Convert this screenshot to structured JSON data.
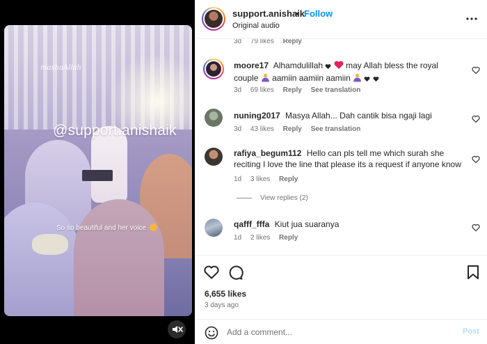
{
  "post": {
    "username": "support.anishaik",
    "separator": "•",
    "follow_label": "Follow",
    "audio": "Original audio",
    "more_icon": "more-horizontal-icon",
    "likes": "6,655 likes",
    "time_ago": "3 days ago"
  },
  "media": {
    "watermark_small": "mashaAllah",
    "overlay_handle": "@support.anishaik",
    "overlay_caption": "So so beautiful and her voice",
    "caption_emoji": "smiling-face-emoji",
    "mute_icon": "speaker-muted-icon"
  },
  "partial_comment": {
    "time": "3d",
    "likes": "79 likes",
    "reply": "Reply"
  },
  "comments": [
    {
      "user": "moore17",
      "text_a": "Alhamdulillah",
      "text_b": "may Allah bless the royal couple",
      "text_c": "aamiin aamiin aamiin",
      "time": "3d",
      "likes": "69 likes",
      "reply": "Reply",
      "translate": "See translation"
    },
    {
      "user": "nuning2017",
      "text": "Masya Allah... Dah cantik bisa ngaji lagi",
      "time": "3d",
      "likes": "43 likes",
      "reply": "Reply",
      "translate": "See translation"
    },
    {
      "user": "rafiya_begum112",
      "text": "Hello can pls tell me which surah she reciting I love the line that please its a request if anyone know",
      "time": "1d",
      "likes": "3 likes",
      "reply": "Reply",
      "view_replies": "View replies (2)"
    },
    {
      "user": "qafff_fffa",
      "text": "Kiut jua suaranya",
      "time": "1d",
      "likes": "2 likes",
      "reply": "Reply"
    }
  ],
  "add_comment": {
    "placeholder": "Add a comment...",
    "post_label": "Post"
  },
  "colors": {
    "accent": "#0095f6",
    "post_disabled": "#b2dffc",
    "heart": "#ed4956",
    "muted_text": "#737373"
  }
}
